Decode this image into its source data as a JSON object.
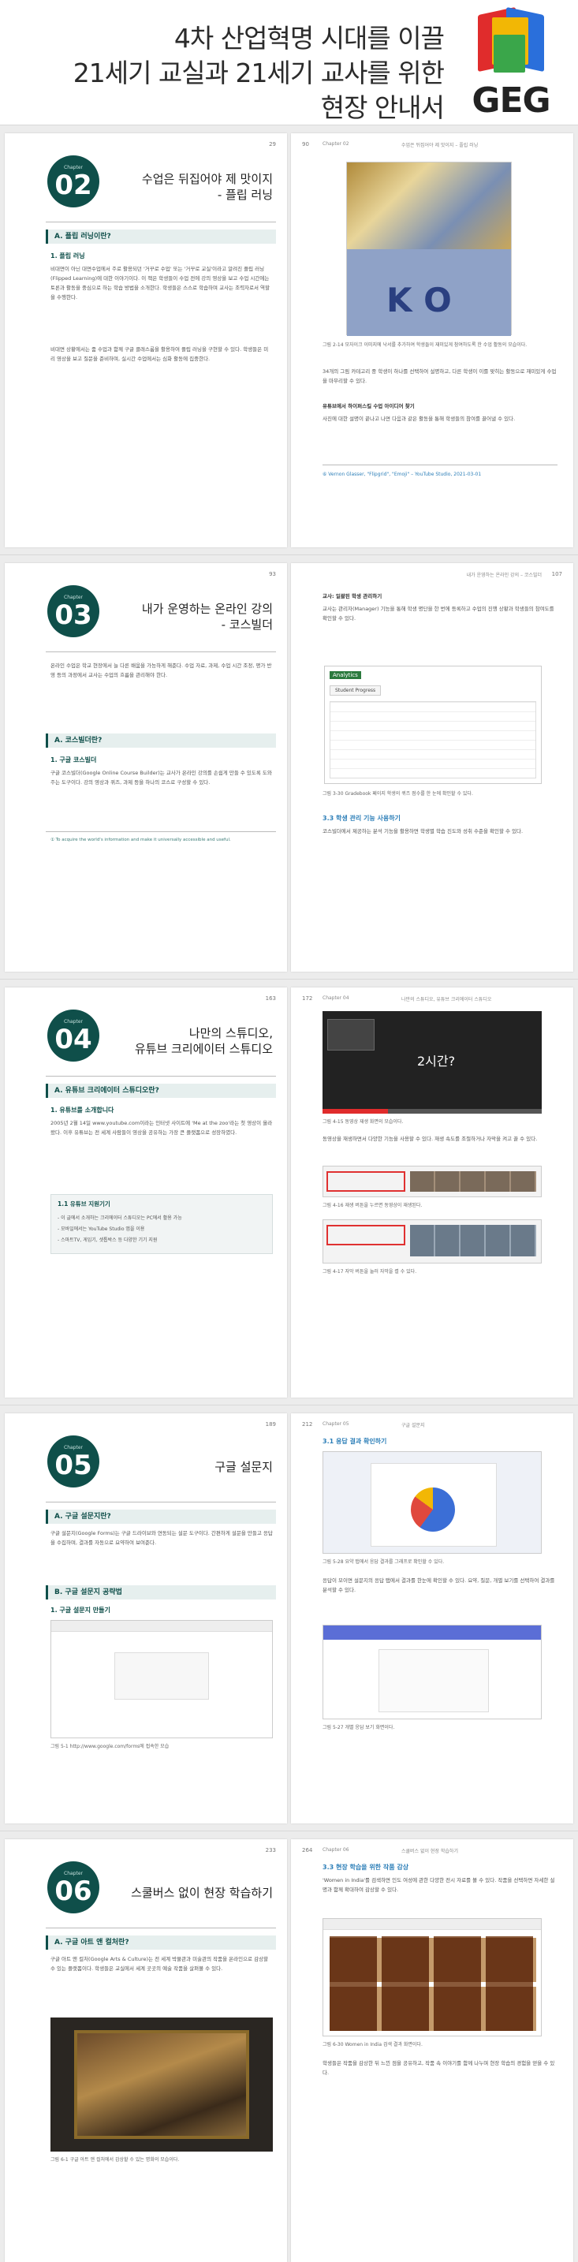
{
  "header": {
    "line1": "4차 산업혁명 시대를 이끌",
    "line2": "21세기 교실과 21세기 교사를 위한",
    "line3": "현장 안내서",
    "logo_text": "GEG"
  },
  "spreads": [
    {
      "left": {
        "page_number": "29",
        "chapter_label": "Chapter",
        "chapter_number": "02",
        "title_line1": "수업은 뒤집어야 제 맛이지",
        "title_line2": "- 플립 러닝",
        "section": "A. 플립 러닝이란?",
        "subsection": "1. 플립 러닝",
        "para1": "비대면이 아닌 대면수업에서 주로 활용되던 '거꾸로 수업' 또는 '거꾸로 교실'이라고 알려진 플립 러닝(Flipped Learning)에 대한 이야기이다. 이 책은 학생들이 수업 전에 강의 영상을 보고 수업 시간에는 토론과 활동을 중심으로 하는 학습 방법을 소개한다. 학생들은 스스로 학습하며 교사는 조력자로서 역할을 수행한다.",
        "para2": "비대면 상황에서는 줌 수업과 함께 구글 클래스룸을 활용하여 플립 러닝을 구현할 수 있다. 학생들은 미리 영상을 보고 질문을 준비하며, 실시간 수업에서는 심화 활동에 집중한다."
      },
      "right": {
        "page_number": "90",
        "chapter_tag": "Chapter 02",
        "running_title": "수업은 뒤집어야 제 맛이지 – 플립 러닝",
        "caption1": "그림 2-14 모자이크 이미지에 낙서를 추가하여 학생들이 재미있게 참여하도록 한 수업 활동의 모습이다.",
        "para1": "34개의 그림 카테고리 중 학생이 하나를 선택하여 설명하고, 다른 학생이 이를 맞히는 활동으로 재미있게 수업을 마무리할 수 있다.",
        "bullet": "유튜브에서 하이퍼스킬 수업 아이디어 찾기",
        "para2": "사진에 대한 설명이 끝나고 나면 다음과 같은 활동을 통해 학생들의 참여를 끌어낼 수 있다.",
        "footnote": "⑥ Vernon Glasser, \"Flipgrid\", \"Emoji\" – YouTube Studio, 2021-03-01"
      }
    },
    {
      "left": {
        "page_number": "93",
        "chapter_label": "Chapter",
        "chapter_number": "03",
        "title_line1": "내가 운영하는 온라인 강의",
        "title_line2": "- 코스빌더",
        "para1": "온라인 수업은 학교 현장에서 늘 다른 배움을 가능하게 해준다. 수업 자료, 과제, 수업 시간 조정, 평가 반영 등의 과정에서 교사는 수업의 흐름을 관리해야 한다.",
        "section": "A. 코스빌더란?",
        "subsection": "1. 구글 코스빌더",
        "para2": "구글 코스빌더(Google Online Course Builder)는 교사가 온라인 강의를 손쉽게 만들 수 있도록 도와주는 도구이다. 강의 영상과 퀴즈, 과제 등을 하나의 코스로 구성할 수 있다.",
        "footnote": "① To acquire the world's information and make it universally accessible and useful."
      },
      "right": {
        "page_number": "107",
        "running_title": "내가 운영하는 온라인 강의 – 코스빌더",
        "bullet": "교사: 일괄된 학생 관리하기",
        "para1": "교사는 관리자(Manager) 기능을 통해 학생 명단을 한 번에 등록하고 수업의 진행 상황과 학생들의 참여도를 확인할 수 있다.",
        "panel_title": "Analytics",
        "panel_tab": "Student Progress",
        "caption1": "그림 3-30 Gradebook 페이지 학생의 퀴즈 점수를 한 눈에 확인할 수 있다.",
        "subhead": "3.3 학생 관리 기능 사용하기",
        "para2": "코스빌더에서 제공하는 분석 기능을 활용하면 학생별 학습 진도와 성취 수준을 확인할 수 있다."
      }
    },
    {
      "left": {
        "page_number": "163",
        "chapter_label": "Chapter",
        "chapter_number": "04",
        "title_line1": "나만의 스튜디오,",
        "title_line2": "유튜브 크리에이터 스튜디오",
        "section": "A. 유튜브 크리에이터 스튜디오란?",
        "subsection": "1. 유튜브를 소개합니다",
        "para1": "2005년 2월 14일 www.youtube.com이라는 인터넷 사이트에 'Me at the zoo'라는 첫 영상이 올라왔다. 이후 유튜브는 전 세계 사람들이 영상을 공유하는 가장 큰 플랫폼으로 성장하였다.",
        "box_title": "1.1 유튜브 지원기기",
        "box_line1": "- 이 글에서 소개하는 크리에이터 스튜디오는 PC에서 활용 가능",
        "box_line2": "- 모바일에서는 YouTube Studio 앱을 이용",
        "box_line3": "- 스마트TV, 게임기, 셋톱박스 등 다양한 기기 지원"
      },
      "right": {
        "page_number": "172",
        "chapter_tag": "Chapter 04",
        "running_title": "나만의 스튜디오, 유튜브 크리에이터 스튜디오",
        "video_label": "2시간?",
        "caption1": "그림 4-15 동영상 재생 화면의 모습이다.",
        "para1": "동영상을 재생하면서 다양한 기능을 사용할 수 있다. 재생 속도를 조절하거나 자막을 켜고 끌 수 있다.",
        "caption2": "그림 4-16 재생 버튼을 누르면 동영상이 재생된다.",
        "caption3": "그림 4-17 자막 버튼을 눌러 자막을 켤 수 있다."
      }
    },
    {
      "left": {
        "page_number": "189",
        "chapter_label": "Chapter",
        "chapter_number": "05",
        "title_line1": "구글 설문지",
        "section": "A. 구글 설문지란?",
        "para1": "구글 설문지(Google Forms)는 구글 드라이브와 연동되는 설문 도구이다. 간편하게 설문을 만들고 응답을 수집하며, 결과를 자동으로 요약하여 보여준다.",
        "section2": "B. 구글 설문지 공략법",
        "subsection": "1. 구글 설문지 만들기",
        "caption1": "그림 5-1 http://www.google.com/forms에 접속한 모습"
      },
      "right": {
        "page_number": "212",
        "chapter_tag": "Chapter 05",
        "running_title": "구글 설문지",
        "blue_head": "3.1 응답 결과 확인하기",
        "caption1": "그림 5-28 요약 탭에서 응답 결과를 그래프로 확인할 수 있다.",
        "para1": "응답이 모이면 설문지의 응답 탭에서 결과를 한눈에 확인할 수 있다. 요약, 질문, 개별 보기를 선택하여 결과를 분석할 수 있다.",
        "caption2": "그림 5-27 개별 응답 보기 화면이다."
      }
    },
    {
      "left": {
        "page_number": "233",
        "chapter_label": "Chapter",
        "chapter_number": "06",
        "title_line1": "스쿨버스 없이 현장 학습하기",
        "section": "A. 구글 아트 앤 컬처란?",
        "para1": "구글 아트 앤 컬처(Google Arts & Culture)는 전 세계 박물관과 미술관의 작품을 온라인으로 감상할 수 있는 플랫폼이다. 학생들은 교실에서 세계 곳곳의 예술 작품을 살펴볼 수 있다.",
        "caption1": "그림 6-1 구글 아트 앤 컬처에서 감상할 수 있는 명화의 모습이다."
      },
      "right": {
        "page_number": "264",
        "chapter_tag": "Chapter 06",
        "running_title": "스쿨버스 없이 현장 학습하기",
        "blue_head": "3.3 현장 학습을 위한 작품 감상",
        "para1": "'Women in India'를 검색하면 인도 여성에 관한 다양한 전시 자료를 볼 수 있다. 작품을 선택하면 자세한 설명과 함께 확대하여 감상할 수 있다.",
        "caption1": "그림 6-30 Women in India 검색 결과 화면이다.",
        "para2": "학생들은 작품을 감상한 뒤 느낀 점을 공유하고, 작품 속 이야기를 함께 나누며 현장 학습의 경험을 얻을 수 있다."
      }
    }
  ]
}
